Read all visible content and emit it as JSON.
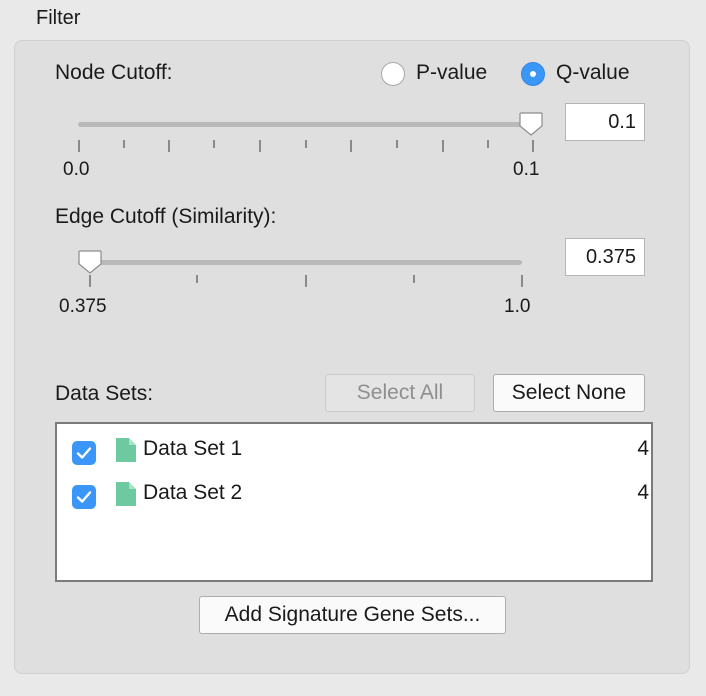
{
  "window": {
    "title": "Filter"
  },
  "node_cutoff": {
    "label": "Node Cutoff:",
    "options": [
      {
        "label": "P-value",
        "selected": false
      },
      {
        "label": "Q-value",
        "selected": true
      }
    ],
    "min_label": "0.0",
    "max_label": "0.1",
    "value": "0.1",
    "slider_fraction": 1.0
  },
  "edge_cutoff": {
    "label": "Edge Cutoff (Similarity):",
    "min_label": "0.375",
    "max_label": "1.0",
    "value": "0.375",
    "slider_fraction": 0.0
  },
  "data_sets": {
    "label": "Data Sets:",
    "select_all_label": "Select All",
    "select_none_label": "Select None",
    "items": [
      {
        "name": "Data Set 1",
        "count": "4",
        "checked": true
      },
      {
        "name": "Data Set 2",
        "count": "4",
        "checked": true
      }
    ]
  },
  "add_signature_label": "Add Signature Gene Sets...",
  "colors": {
    "accent": "#3a96f7",
    "doc_icon": "#6cc9a0"
  },
  "icons": {
    "checkbox": "checkmark-icon",
    "data_set": "document-icon",
    "slider_thumb": "slider-thumb-icon"
  }
}
